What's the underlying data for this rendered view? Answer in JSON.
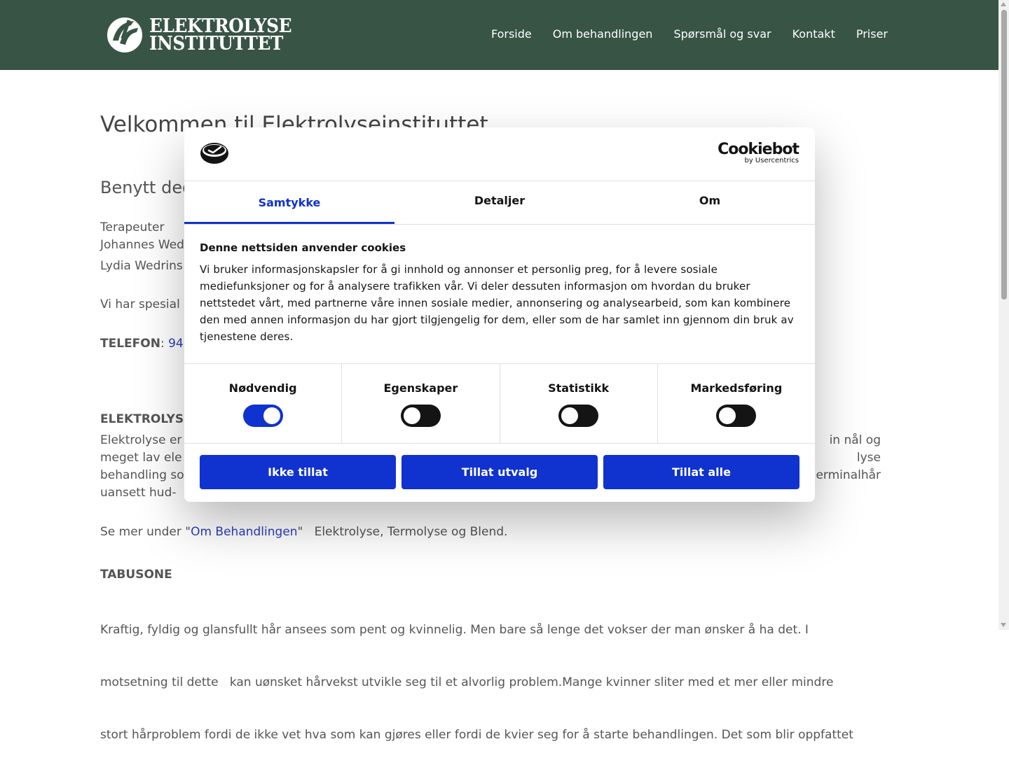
{
  "header": {
    "logo_line1": "ELEKTROLYSE",
    "logo_line2": "INSTITUTTET",
    "nav": [
      "Forside",
      "Om behandlingen",
      "Spørsmål og svar",
      "Kontakt",
      "Priser"
    ]
  },
  "page": {
    "heading": "Velkommen til Elektrolyseinstituttet",
    "subheading": "Benytt deg",
    "therapists_label": "Terapeuter",
    "therapist1": "Johannes Wed",
    "therapist2": "Lydia Wedrins",
    "special": "Vi har spesial",
    "phone_label": "TELEFON",
    "phone_sep": ":",
    "phone_value": "94",
    "section1_title": "ELEKTROLYS",
    "section1_lines": [
      "Elektrolyse er",
      "meget lav ele",
      "behandling so",
      "uansett hud-"
    ],
    "section1_right": [
      "in nål og",
      "lyse",
      "erminalhår"
    ],
    "see_more_prefix": "Se mer under \"",
    "see_more_link": "Om Behandlingen",
    "see_more_suffix": "\"   Elektrolyse, Termolyse og Blend.",
    "section2_title": "TABUSONE",
    "section2_line1": "Kraftig, fyldig og glansfullt hår ansees som pent og kvinnelig. Men bare så lenge det vokser der man ønsker å ha det. I",
    "section2_line2": "motsetning til dette   kan uønsket hårvekst utvikle seg til et alvorlig problem.Mange kvinner sliter med et mer eller mindre",
    "section2_line3": "stort hårproblem fordi de ikke vet hva som kan gjøres eller fordi de kvier seg for å starte behandlingen. Det som blir oppfattet"
  },
  "cookie": {
    "brand_name": "Cookiebot",
    "brand_sub": "by Usercentrics",
    "tabs": [
      "Samtykke",
      "Detaljer",
      "Om"
    ],
    "active_tab": "Samtykke",
    "title": "Denne nettsiden anvender cookies",
    "text": "Vi bruker informasjonskapsler for å gi innhold og annonser et personlig preg, for å levere sosiale mediefunksjoner og for å analysere trafikken vår. Vi deler dessuten informasjon om hvordan du bruker nettstedet vårt, med partnerne våre innen sosiale medier, annonsering og analysearbeid, som kan kombinere den med annen informasjon du har gjort tilgjengelig for dem, eller som de har samlet inn gjennom din bruk av tjenestene deres.",
    "toggles": [
      {
        "label": "Nødvendig",
        "on": true
      },
      {
        "label": "Egenskaper",
        "on": false
      },
      {
        "label": "Statistikk",
        "on": false
      },
      {
        "label": "Markedsføring",
        "on": false
      }
    ],
    "buttons": [
      "Ikke tillat",
      "Tillat utvalg",
      "Tillat alle"
    ]
  },
  "colors": {
    "header_bg": "#385445",
    "accent": "#1032cf",
    "link": "#2c3cbb"
  }
}
